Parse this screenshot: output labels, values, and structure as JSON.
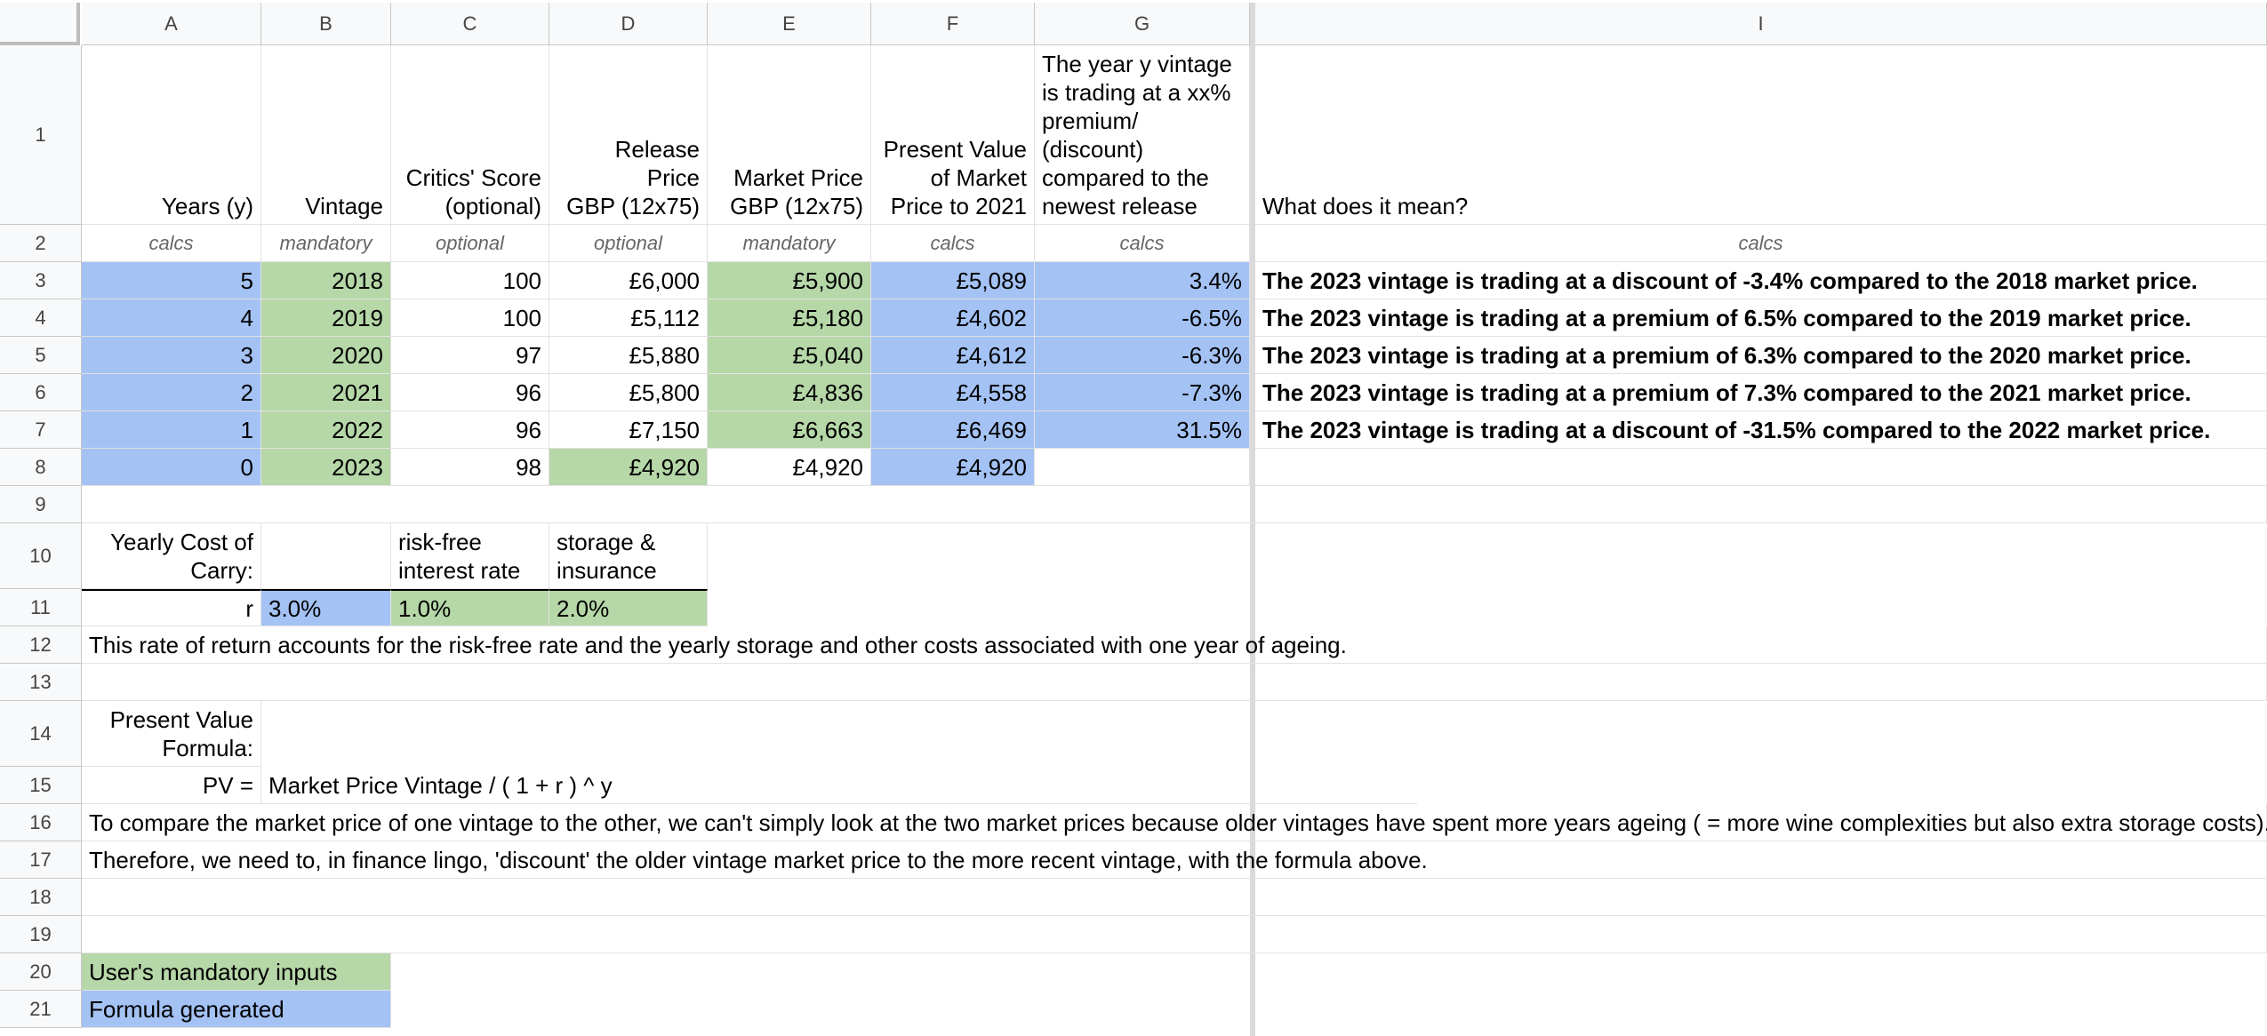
{
  "columns": [
    "A",
    "B",
    "C",
    "D",
    "E",
    "F",
    "G",
    "I"
  ],
  "rows": [
    "1",
    "2",
    "3",
    "4",
    "5",
    "6",
    "7",
    "8",
    "9",
    "10",
    "11",
    "12",
    "13",
    "14",
    "15",
    "16",
    "17",
    "18",
    "19",
    "20",
    "21"
  ],
  "header": {
    "a": "Years (y)",
    "b": "Vintage",
    "c": "Critics' Score\n(optional)",
    "d": "Release Price\nGBP (12x75)",
    "e": "Market Price\nGBP (12x75)",
    "f": "Present Value\nof Market\nPrice to 2021",
    "g": "The year y vintage\nis trading at a xx%\npremium/\n(discount)\ncompared to the\nnewest release",
    "i": "What does it mean?"
  },
  "subheader": {
    "a": "calcs",
    "b": "mandatory",
    "c": "optional",
    "d": "optional",
    "e": "mandatory",
    "f": "calcs",
    "g": "calcs",
    "i": "calcs"
  },
  "table": [
    {
      "years": "5",
      "vintage": "2018",
      "score": "100",
      "release": "£6,000",
      "market": "£5,900",
      "pv": "£5,089",
      "prem": "3.4%",
      "meaning": "The 2023 vintage is trading at a discount of -3.4% compared to the 2018 market price."
    },
    {
      "years": "4",
      "vintage": "2019",
      "score": "100",
      "release": "£5,112",
      "market": "£5,180",
      "pv": "£4,602",
      "prem": "-6.5%",
      "meaning": "The 2023 vintage is trading at a premium of 6.5% compared to the 2019 market price."
    },
    {
      "years": "3",
      "vintage": "2020",
      "score": "97",
      "release": "£5,880",
      "market": "£5,040",
      "pv": "£4,612",
      "prem": "-6.3%",
      "meaning": "The 2023 vintage is trading at a premium of 6.3% compared to the 2020 market price."
    },
    {
      "years": "2",
      "vintage": "2021",
      "score": "96",
      "release": "£5,800",
      "market": "£4,836",
      "pv": "£4,558",
      "prem": "-7.3%",
      "meaning": "The 2023 vintage is trading at a premium of 7.3% compared to the 2021 market price."
    },
    {
      "years": "1",
      "vintage": "2022",
      "score": "96",
      "release": "£7,150",
      "market": "£6,663",
      "pv": "£6,469",
      "prem": "31.5%",
      "meaning": "The 2023 vintage is trading at a discount of -31.5% compared to the 2022 market price."
    },
    {
      "years": "0",
      "vintage": "2023",
      "score": "98",
      "release": "£4,920",
      "market": "£4,920",
      "pv": "£4,920",
      "prem": "",
      "meaning": ""
    }
  ],
  "carry": {
    "label": "Yearly Cost of\nCarry:",
    "rf_label": "risk-free\ninterest rate",
    "storage_label": "storage &\ninsurance",
    "r_label": "r",
    "r_value": "3.0%",
    "rf_value": "1.0%",
    "storage_value": "2.0%"
  },
  "notes": {
    "row12": "This rate of return accounts for the risk-free rate and the yearly storage and other costs associated with one year of ageing.",
    "pv_label": "Present Value\nFormula:",
    "pv_eq_label": "PV =",
    "pv_formula": "Market Price Vintage / ( 1 + r ) ^ y",
    "row16": "To compare the market price of one vintage to the other, we can't simply look at the two market prices because older vintages have spent more years ageing ( = more wine complexities but also extra storage costs).",
    "row17": "Therefore, we need to, in finance lingo, 'discount' the older vintage market price to the more recent vintage, with the formula above."
  },
  "legend": {
    "mandatory": "User's mandatory inputs",
    "formula": "Formula generated"
  },
  "colors": {
    "formula_blue": "#a4c2f4",
    "input_green": "#b6d7a8"
  }
}
